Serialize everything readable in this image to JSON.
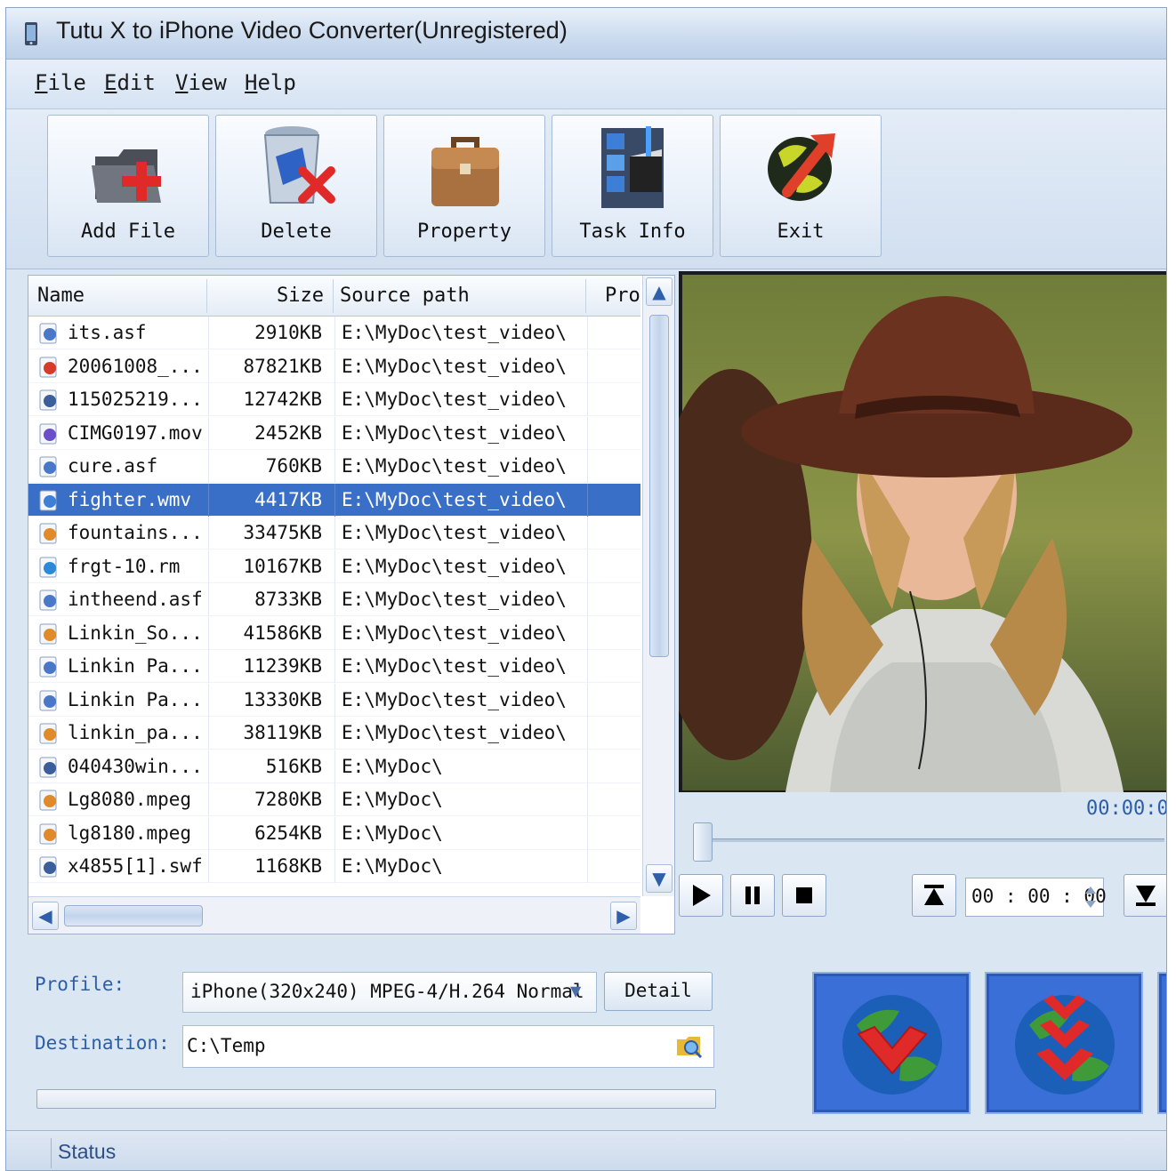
{
  "window": {
    "title": "Tutu X to iPhone Video Converter(Unregistered)"
  },
  "menu": [
    {
      "label": "File",
      "accel": "F",
      "rest": "ile"
    },
    {
      "label": "Edit",
      "accel": "E",
      "rest": "dit"
    },
    {
      "label": "View",
      "accel": "V",
      "rest": "iew"
    },
    {
      "label": "Help",
      "accel": "H",
      "rest": "elp"
    }
  ],
  "toolbar": {
    "add_file": "Add File",
    "delete": "Delete",
    "property": "Property",
    "task_info": "Task Info",
    "exit": "Exit"
  },
  "file_list": {
    "columns": {
      "name": "Name",
      "size": "Size",
      "source_path": "Source path",
      "profile": "Pro;"
    },
    "rows": [
      {
        "name": "its.asf",
        "size": "2910KB",
        "path": "E:\\MyDoc\\test_video\\",
        "icon": "asf-icon"
      },
      {
        "name": "20061008_...",
        "size": "87821KB",
        "path": "E:\\MyDoc\\test_video\\",
        "icon": "avi-icon"
      },
      {
        "name": "115025219...",
        "size": "12742KB",
        "path": "E:\\MyDoc\\test_video\\",
        "icon": "flash-icon"
      },
      {
        "name": "CIMG0197.mov",
        "size": "2452KB",
        "path": "E:\\MyDoc\\test_video\\",
        "icon": "mov-icon"
      },
      {
        "name": "cure.asf",
        "size": "760KB",
        "path": "E:\\MyDoc\\test_video\\",
        "icon": "asf-icon"
      },
      {
        "name": "fighter.wmv",
        "size": "4417KB",
        "path": "E:\\MyDoc\\test_video\\",
        "icon": "wmv-icon",
        "selected": true
      },
      {
        "name": "fountains...",
        "size": "33475KB",
        "path": "E:\\MyDoc\\test_video\\",
        "icon": "mpeg-icon"
      },
      {
        "name": "frgt-10.rm",
        "size": "10167KB",
        "path": "E:\\MyDoc\\test_video\\",
        "icon": "rm-icon"
      },
      {
        "name": "intheend.asf",
        "size": "8733KB",
        "path": "E:\\MyDoc\\test_video\\",
        "icon": "asf-icon"
      },
      {
        "name": "Linkin_So...",
        "size": "41586KB",
        "path": "E:\\MyDoc\\test_video\\",
        "icon": "mpeg-icon"
      },
      {
        "name": "Linkin Pa...",
        "size": "11239KB",
        "path": "E:\\MyDoc\\test_video\\",
        "icon": "asf-icon"
      },
      {
        "name": "Linkin Pa...",
        "size": "13330KB",
        "path": "E:\\MyDoc\\test_video\\",
        "icon": "asf-icon"
      },
      {
        "name": "linkin_pa...",
        "size": "38119KB",
        "path": "E:\\MyDoc\\test_video\\",
        "icon": "mpeg-icon"
      },
      {
        "name": "040430win...",
        "size": "516KB",
        "path": "E:\\MyDoc\\",
        "icon": "flash-icon"
      },
      {
        "name": "Lg8080.mpeg",
        "size": "7280KB",
        "path": "E:\\MyDoc\\",
        "icon": "mpeg-icon"
      },
      {
        "name": "lg8180.mpeg",
        "size": "6254KB",
        "path": "E:\\MyDoc\\",
        "icon": "mpeg-icon"
      },
      {
        "name": "x4855[1].swf",
        "size": "1168KB",
        "path": "E:\\MyDoc\\",
        "icon": "flash-icon"
      }
    ]
  },
  "player": {
    "elapsed": "00:00:0",
    "seek_position": 0,
    "time_field": "00 : 00 : 00"
  },
  "profile": {
    "label": "Profile:",
    "value": "iPhone(320x240) MPEG-4/H.264 Normal",
    "detail_button": "Detail"
  },
  "destination": {
    "label": "Destination:",
    "value": "C:\\Temp"
  },
  "progress": {
    "fraction": 0
  },
  "status": {
    "text": "Status"
  },
  "colors": {
    "selection": "#3a6fc8",
    "accent": "#2c5ea8",
    "convert_bg": "#3b6fd8"
  }
}
